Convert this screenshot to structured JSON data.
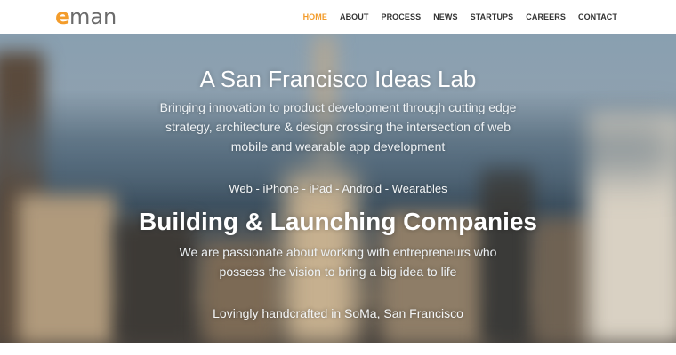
{
  "brand": {
    "logo_e": "e",
    "logo_rest": "man",
    "accent": "#f39c2b"
  },
  "nav": {
    "items": [
      {
        "label": "HOME",
        "active": true
      },
      {
        "label": "ABOUT",
        "active": false
      },
      {
        "label": "PROCESS",
        "active": false
      },
      {
        "label": "NEWS",
        "active": false
      },
      {
        "label": "STARTUPS",
        "active": false
      },
      {
        "label": "CAREERS",
        "active": false
      },
      {
        "label": "CONTACT",
        "active": false
      }
    ]
  },
  "hero": {
    "title": "A San Francisco Ideas Lab",
    "subtitle": "Bringing innovation to product development through cutting edge strategy, architecture & design crossing the intersection of web mobile and wearable app development",
    "platforms": "Web - iPhone - iPad - Android - Wearables",
    "title2": "Building & Launching Companies",
    "subtitle2": "We are passionate about working with entrepreneurs who possess the vision to bring a big idea to life",
    "tagline": "Lovingly handcrafted in SoMa, San Francisco"
  }
}
